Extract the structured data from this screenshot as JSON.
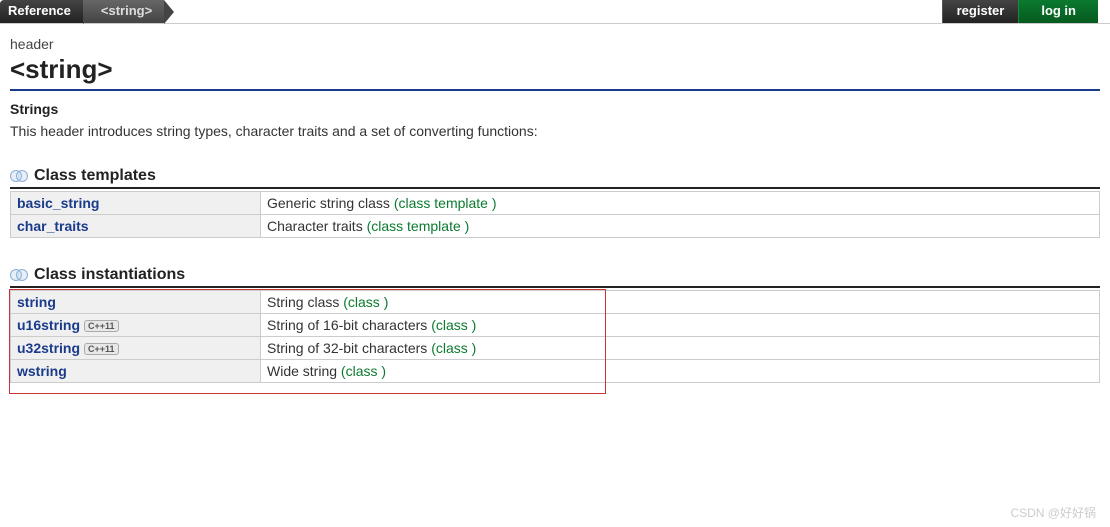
{
  "topbar": {
    "reference_label": "Reference",
    "current_label": "<string>",
    "register_label": "register",
    "login_label": "log in"
  },
  "header": {
    "type": "header",
    "title": "<string>",
    "subtitle": "Strings",
    "description": "This header introduces string types, character traits and a set of converting functions:"
  },
  "section_templates": {
    "title": "Class templates",
    "rows": [
      {
        "name": "basic_string",
        "desc": "Generic string class",
        "type": "(class template )"
      },
      {
        "name": "char_traits",
        "desc": "Character traits",
        "type": "(class template )"
      }
    ]
  },
  "section_instantiations": {
    "title": "Class instantiations",
    "rows": [
      {
        "name": "string",
        "desc": "String class",
        "type": "(class )",
        "cpp11": false
      },
      {
        "name": "u16string",
        "desc": "String of 16-bit characters",
        "type": "(class )",
        "cpp11": true
      },
      {
        "name": "u32string",
        "desc": "String of 32-bit characters",
        "type": "(class )",
        "cpp11": true
      },
      {
        "name": "wstring",
        "desc": "Wide string",
        "type": "(class )",
        "cpp11": false
      }
    ]
  },
  "badges": {
    "cpp11": "C++11"
  },
  "watermark": "CSDN @好好锅"
}
